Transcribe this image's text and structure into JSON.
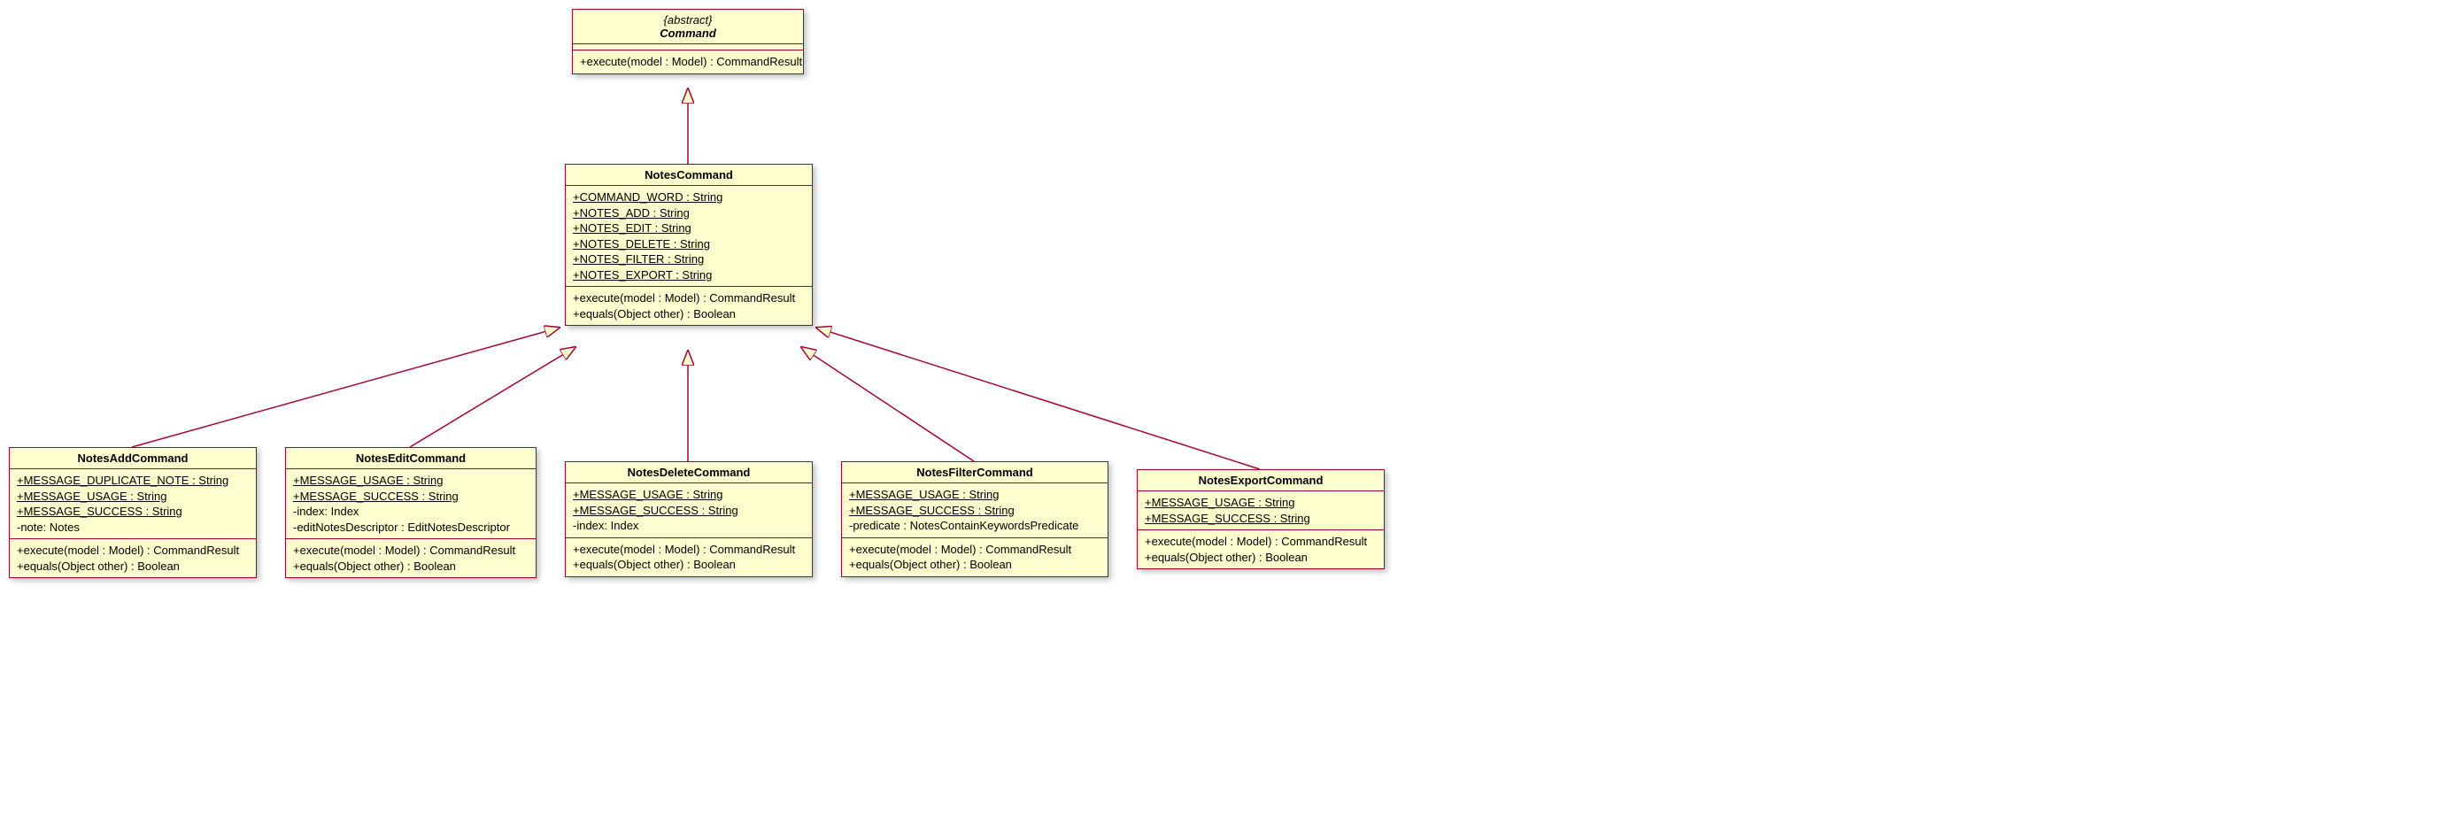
{
  "chart_data": {
    "type": "diagram",
    "diagram_type": "uml_class",
    "relationships": [
      {
        "from": "NotesCommand",
        "to": "Command",
        "type": "generalization"
      },
      {
        "from": "NotesAddCommand",
        "to": "NotesCommand",
        "type": "generalization"
      },
      {
        "from": "NotesEditCommand",
        "to": "NotesCommand",
        "type": "generalization"
      },
      {
        "from": "NotesDeleteCommand",
        "to": "NotesCommand",
        "type": "generalization"
      },
      {
        "from": "NotesFilterCommand",
        "to": "NotesCommand",
        "type": "generalization"
      },
      {
        "from": "NotesExportCommand",
        "to": "NotesCommand",
        "type": "generalization"
      }
    ]
  },
  "command": {
    "stereotype": "{abstract}",
    "name": "Command",
    "ops": [
      "+execute(model : Model) : CommandResult"
    ]
  },
  "notesCommand": {
    "name": "NotesCommand",
    "attrs": [
      "+COMMAND_WORD : String",
      "+NOTES_ADD : String",
      "+NOTES_EDIT : String",
      "+NOTES_DELETE : String",
      "+NOTES_FILTER : String",
      "+NOTES_EXPORT : String"
    ],
    "ops": [
      "+execute(model : Model) : CommandResult",
      "+equals(Object other) : Boolean"
    ]
  },
  "add": {
    "name": "NotesAddCommand",
    "attrs": [
      "+MESSAGE_DUPLICATE_NOTE : String",
      "+MESSAGE_USAGE : String",
      "+MESSAGE_SUCCESS : String",
      "-note: Notes"
    ],
    "ops": [
      "+execute(model : Model) : CommandResult",
      "+equals(Object other) : Boolean"
    ]
  },
  "edit": {
    "name": "NotesEditCommand",
    "attrs": [
      "+MESSAGE_USAGE : String",
      "+MESSAGE_SUCCESS : String",
      "-index: Index",
      "-editNotesDescriptor : EditNotesDescriptor"
    ],
    "ops": [
      "+execute(model : Model) : CommandResult",
      "+equals(Object other) : Boolean"
    ]
  },
  "delete": {
    "name": "NotesDeleteCommand",
    "attrs": [
      "+MESSAGE_USAGE : String",
      "+MESSAGE_SUCCESS : String",
      "-index: Index"
    ],
    "ops": [
      "+execute(model : Model) : CommandResult",
      "+equals(Object other) : Boolean"
    ]
  },
  "filter": {
    "name": "NotesFilterCommand",
    "attrs": [
      "+MESSAGE_USAGE : String",
      "+MESSAGE_SUCCESS : String",
      "-predicate : NotesContainKeywordsPredicate"
    ],
    "ops": [
      "+execute(model : Model) : CommandResult",
      "+equals(Object other) : Boolean"
    ]
  },
  "export": {
    "name": "NotesExportCommand",
    "attrs": [
      "+MESSAGE_USAGE : String",
      "+MESSAGE_SUCCESS : String"
    ],
    "ops": [
      "+execute(model : Model) : CommandResult",
      "+equals(Object other) : Boolean"
    ]
  }
}
